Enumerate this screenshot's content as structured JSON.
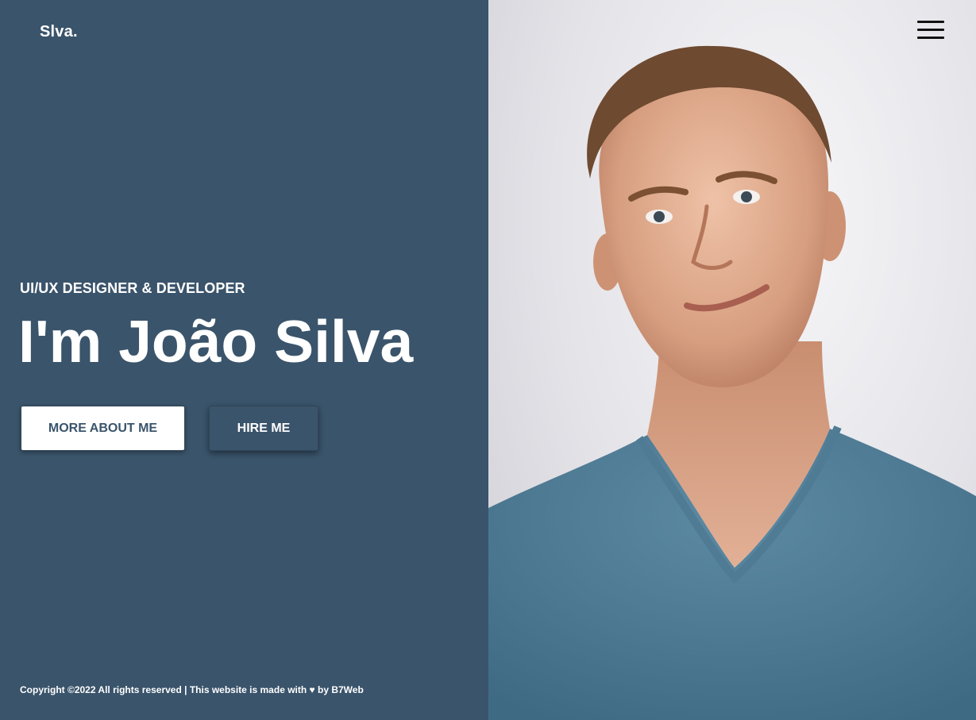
{
  "header": {
    "logo": "Slva.",
    "menu_icon": "hamburger-menu-icon"
  },
  "hero": {
    "subtitle": "UI/UX DESIGNER & DEVELOPER",
    "headline": "I'm João Silva",
    "buttons": {
      "about_label": "MORE ABOUT ME",
      "hire_label": "HIRE ME"
    }
  },
  "footer": {
    "copyright": "Copyright ©2022 All rights reserved | This website is made with ♥ by B7Web"
  },
  "colors": {
    "primary": "#3a546b",
    "text_light": "#ffffff",
    "menu_icon": "#111111"
  },
  "image": {
    "subject": "portrait"
  }
}
